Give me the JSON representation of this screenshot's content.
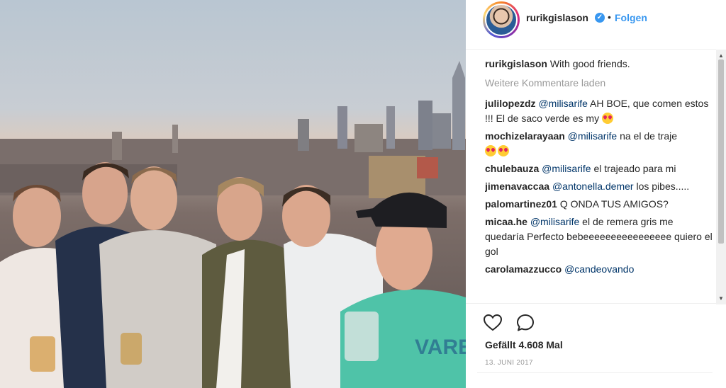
{
  "post": {
    "username": "rurikgislason",
    "verified_mark": "✓",
    "separator": "•",
    "follow_label": "Folgen",
    "avatar_icon": "profile-avatar",
    "caption": {
      "user": "rurikgislason",
      "text": "With good friends."
    },
    "load_more_label": "Weitere Kommentare laden",
    "comments": [
      {
        "user": "julilopezdz",
        "mention": "@milisarife",
        "text": "AH BOE, que comen estos !!! El de saco verde es my"
      },
      {
        "user": "mochizelarayaan",
        "mention": "@milisarife",
        "text": "na el de traje"
      },
      {
        "user": "chulebauza",
        "mention": "@milisarife",
        "text": "el trajeado para mi"
      },
      {
        "user": "jimenavaccaa",
        "mention": "@antonella.demer",
        "text": "los pibes....."
      },
      {
        "user": "palomartinez01",
        "mention": "",
        "text": "Q ONDA TUS AMIGOS?"
      },
      {
        "user": "micaa.he",
        "mention": "@milisarife",
        "text": "el de remera gris me quedaría Perfecto bebeeeeeeeeeeeeeeee quiero el gol"
      },
      {
        "user": "carolamazzucco",
        "mention": "@candeovando",
        "text": ""
      }
    ],
    "likes_label": "Gefällt 4.608 Mal",
    "date_label": "13. JUNI 2017",
    "icons": {
      "like": "heart-icon",
      "comment": "comment-bubble-icon"
    },
    "colors": {
      "link": "#3897f0",
      "text": "#262626",
      "muted": "#999999",
      "mention": "#003569"
    }
  }
}
